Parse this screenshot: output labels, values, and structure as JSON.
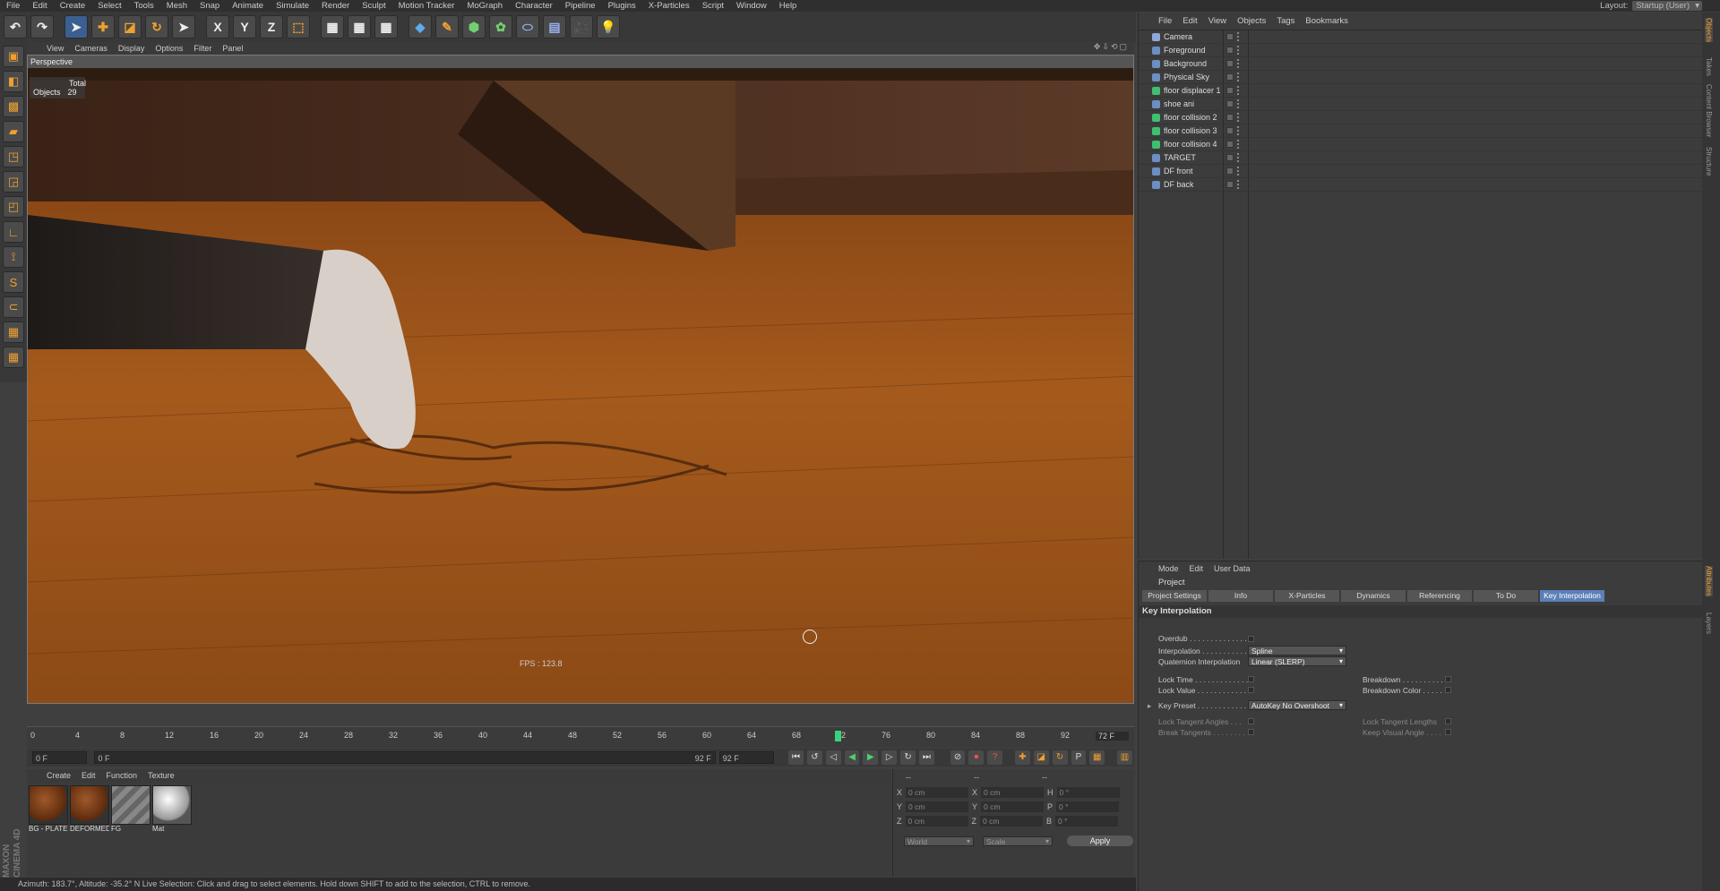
{
  "menubar": {
    "items": [
      "File",
      "Edit",
      "Create",
      "Select",
      "Tools",
      "Mesh",
      "Snap",
      "Animate",
      "Simulate",
      "Render",
      "Sculpt",
      "Motion Tracker",
      "MoGraph",
      "Character",
      "Pipeline",
      "Plugins",
      "X-Particles",
      "Script",
      "Window",
      "Help"
    ],
    "layout_label": "Layout:",
    "layout_value": "Startup (User)"
  },
  "viewport": {
    "menu": [
      "View",
      "Cameras",
      "Display",
      "Options",
      "Filter",
      "Panel"
    ],
    "label": "Perspective",
    "hud": {
      "total_label": "Total",
      "objects_label": "Objects",
      "objects_value": "29"
    },
    "fps": "FPS : 123.8"
  },
  "timeline": {
    "ticks": [
      "0",
      "4",
      "8",
      "12",
      "16",
      "20",
      "24",
      "28",
      "32",
      "36",
      "40",
      "44",
      "48",
      "52",
      "56",
      "60",
      "64",
      "68",
      "72",
      "76",
      "80",
      "84",
      "88",
      "92"
    ],
    "current": "72",
    "end_field": "72 F"
  },
  "transport": {
    "start": "0 F",
    "range_start": "0 F",
    "range_end": "92 F",
    "end": "92 F"
  },
  "materials": {
    "menu": [
      "Create",
      "Edit",
      "Function",
      "Texture"
    ],
    "items": [
      {
        "label": "BG - PLATE",
        "color": "#7a3c12"
      },
      {
        "label": "DEFORMED",
        "color": "#7a3c12"
      },
      {
        "label": "FG",
        "color": "#777777"
      },
      {
        "label": "Mat",
        "color": "#c8c8c8"
      }
    ]
  },
  "coords": {
    "header": [
      "--",
      "--",
      "--"
    ],
    "rows": [
      {
        "a": "X",
        "av": "0 cm",
        "b": "X",
        "bv": "0 cm",
        "c": "H",
        "cv": "0 °"
      },
      {
        "a": "Y",
        "av": "0 cm",
        "b": "Y",
        "bv": "0 cm",
        "c": "P",
        "cv": "0 °"
      },
      {
        "a": "Z",
        "av": "0 cm",
        "b": "Z",
        "bv": "0 cm",
        "c": "B",
        "cv": "0 °"
      }
    ],
    "world": "World",
    "scale": "Scale",
    "apply": "Apply"
  },
  "status": "Azimuth: 183.7°, Altitude: -35.2°  N     Live Selection: Click and drag to select elements. Hold down SHIFT to add to the selection, CTRL to remove.",
  "brand": {
    "line1": "MAXON",
    "line2": "CINEMA 4D"
  },
  "objects": {
    "menu": [
      "File",
      "Edit",
      "View",
      "Objects",
      "Tags",
      "Bookmarks"
    ],
    "items": [
      "Camera",
      "Foreground",
      "Background",
      "Physical Sky",
      "floor displacer 1",
      "shoe ani",
      "floor collision 2",
      "floor collision 3",
      "floor collision 4",
      "TARGET",
      "DF front",
      "DF back"
    ]
  },
  "attributes": {
    "menu": [
      "Mode",
      "Edit",
      "User Data"
    ],
    "title": "Project",
    "tabs": [
      "Project Settings",
      "Info",
      "X-Particles",
      "Dynamics",
      "Referencing",
      "To Do",
      "Key Interpolation"
    ],
    "section": "Key Interpolation",
    "overdub": "Overdub . . . . . . . . . . . . . .",
    "interpolation": "Interpolation . . . . . . . . . . .",
    "interpolation_value": "Spline",
    "quat": "Quaternion Interpolation",
    "quat_value": "Linear (SLERP)",
    "lock_time": "Lock Time . . . . . . . . . . . . .",
    "breakdown": "Breakdown . . . . . . . . . . .",
    "lock_value": "Lock Value . . . . . . . . . . . .",
    "breakdown_color": "Breakdown Color . . . . .",
    "key_preset": "Key Preset . . . . . . . . . . . .",
    "key_preset_value": "AutoKey No Overshoot",
    "lock_tangent_angles": "Lock Tangent Angles . . .",
    "lock_tangent_lengths": "Lock Tangent Lengths",
    "break_tangents": "Break Tangents . . . . . . . .",
    "keep_visual_angle": "Keep Visual Angle . . . ."
  },
  "sidetabs": {
    "right_top": [
      "Objects",
      "Takes",
      "Content Browser",
      "Structure"
    ],
    "right_bottom": [
      "Attributes",
      "Layers"
    ]
  },
  "colors": {
    "accent": "#5b80b8",
    "playhead": "#39d47a"
  }
}
